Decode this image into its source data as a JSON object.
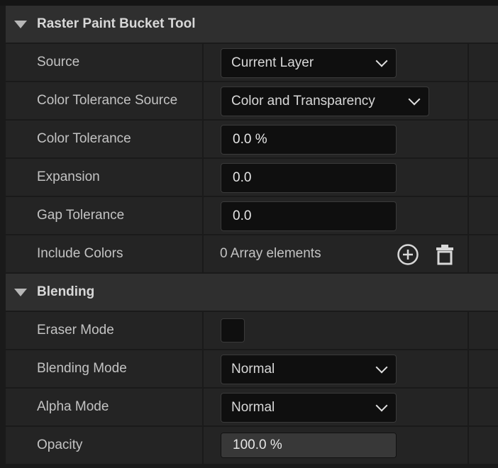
{
  "sections": [
    {
      "title": "Raster Paint Bucket Tool",
      "rows": [
        {
          "name": "Source",
          "type": "dropdown",
          "value": "Current Layer"
        },
        {
          "name": "Color Tolerance Source",
          "type": "dropdown",
          "value": "Color and Transparency"
        },
        {
          "name": "Color Tolerance",
          "type": "text",
          "value": "0.0 %"
        },
        {
          "name": "Expansion",
          "type": "text",
          "value": "0.0"
        },
        {
          "name": "Gap Tolerance",
          "type": "text",
          "value": "0.0"
        },
        {
          "name": "Include Colors",
          "type": "array",
          "value": "0 Array elements",
          "icons": [
            "add-circle-icon",
            "trash-icon"
          ]
        }
      ]
    },
    {
      "title": "Blending",
      "rows": [
        {
          "name": "Eraser Mode",
          "type": "checkbox",
          "checked": false
        },
        {
          "name": "Blending Mode",
          "type": "dropdown",
          "value": "Normal"
        },
        {
          "name": "Alpha Mode",
          "type": "dropdown",
          "value": "Normal"
        },
        {
          "name": "Opacity",
          "type": "slider",
          "value": "100.0 %",
          "fraction": 1.0
        }
      ]
    }
  ],
  "colors": {
    "background": "#1a1a1a",
    "header": "#2f2f2f",
    "row": "#242424",
    "field": "#0f0f0f",
    "text": "#c3c3c3"
  }
}
